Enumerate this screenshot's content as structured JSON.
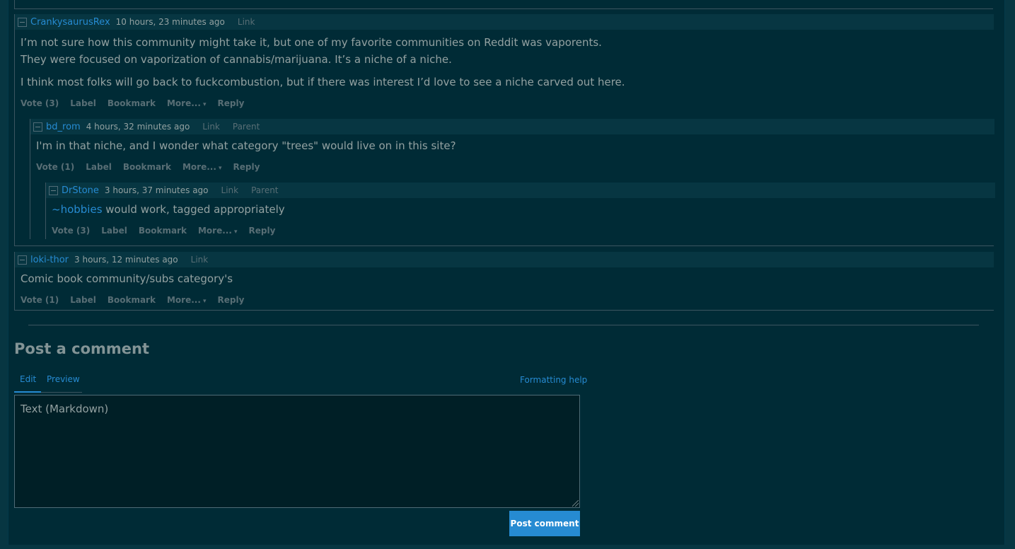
{
  "comments": [
    {
      "user": "CrankysaurusRex",
      "time": "10 hours, 23 minutes ago",
      "links": [
        "Link"
      ],
      "paragraphs": [
        "I’m not sure how this community might take it, but one of my favorite communities on Reddit was vaporents.",
        "They were focused on vaporization of cannabis/marijuana. It’s a niche of a niche.",
        "I think most folks will go back to fuckcombustion, but if there was interest I’d love to see a niche carved out here."
      ],
      "actions": {
        "vote": "Vote (3)",
        "label": "Label",
        "bookmark": "Bookmark",
        "more": "More...",
        "reply": "Reply"
      }
    },
    {
      "user": "bd_rom",
      "time": "4 hours, 32 minutes ago",
      "links": [
        "Link",
        "Parent"
      ],
      "paragraphs": [
        "I'm in that niche, and I wonder what category \"trees\" would live on in this site?"
      ],
      "actions": {
        "vote": "Vote (1)",
        "label": "Label",
        "bookmark": "Bookmark",
        "more": "More...",
        "reply": "Reply"
      }
    },
    {
      "user": "DrStone",
      "time": "3 hours, 37 minutes ago",
      "links": [
        "Link",
        "Parent"
      ],
      "tag": "~hobbies",
      "paragraphs": [
        " would work, tagged appropriately"
      ],
      "actions": {
        "vote": "Vote (3)",
        "label": "Label",
        "bookmark": "Bookmark",
        "more": "More...",
        "reply": "Reply"
      }
    },
    {
      "user": "loki-thor",
      "time": "3 hours, 12 minutes ago",
      "links": [
        "Link"
      ],
      "paragraphs": [
        "Comic book community/subs category's"
      ],
      "actions": {
        "vote": "Vote (1)",
        "label": "Label",
        "bookmark": "Bookmark",
        "more": "More...",
        "reply": "Reply"
      }
    }
  ],
  "post_comment": {
    "title": "Post a comment",
    "tab_edit": "Edit",
    "tab_preview": "Preview",
    "formatting_help": "Formatting help",
    "placeholder": "Text (Markdown)",
    "button": "Post comment"
  },
  "colors": {
    "background": "#002b36",
    "accent": "#268bd2",
    "text": "#93a1a1",
    "header": "#073642"
  }
}
